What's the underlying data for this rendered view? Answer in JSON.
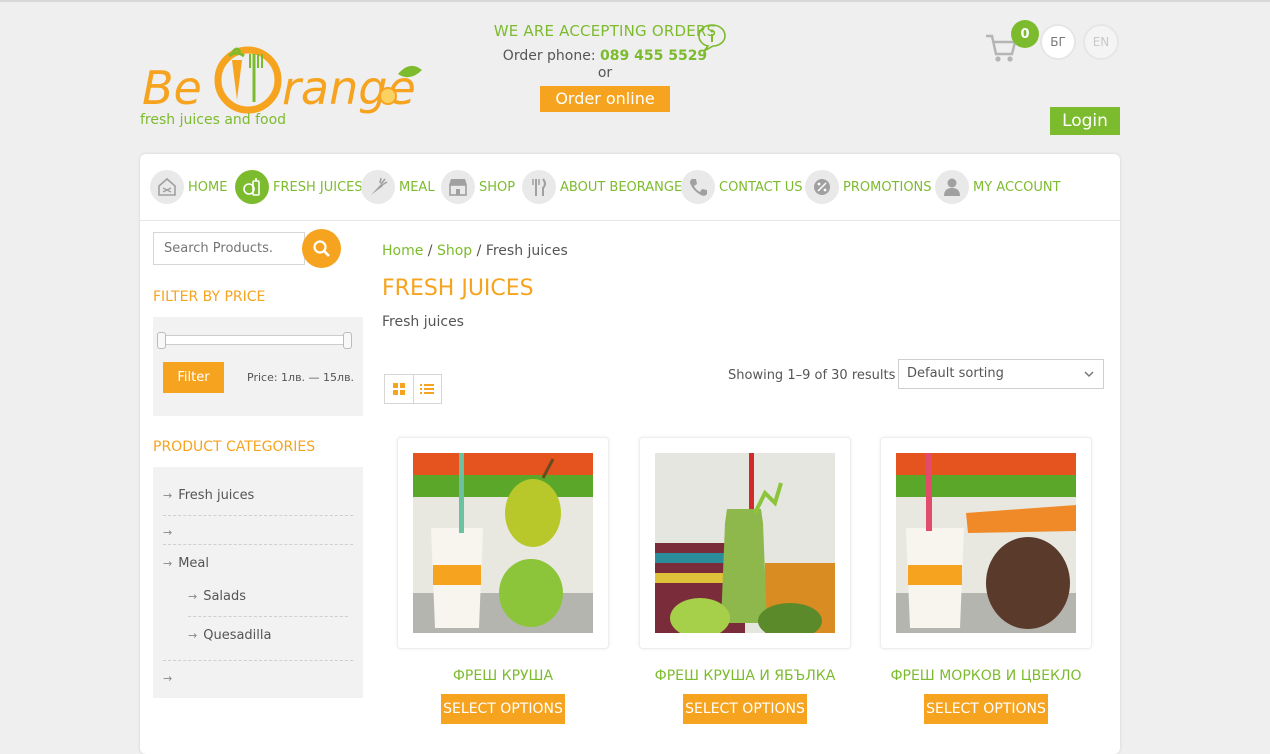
{
  "brand": {
    "logo_text": "BeOrange",
    "tagline": "fresh juices and food"
  },
  "header": {
    "accepting": "WE ARE ACCEPTING ORDERS",
    "order_phone_label": "Order phone:",
    "order_phone": "089 455 5529",
    "or": "or",
    "order_online": "Order online",
    "cart_count": "0",
    "lang_bg": "БГ",
    "lang_en": "EN",
    "login": "Login"
  },
  "nav": [
    {
      "label": "HOME",
      "icon": "home-icon"
    },
    {
      "label": "FRESH JUICES",
      "icon": "juice-icon"
    },
    {
      "label": "MEAL",
      "icon": "carrot-icon"
    },
    {
      "label": "SHOP",
      "icon": "shop-icon"
    },
    {
      "label": "ABOUT BEORANGE",
      "icon": "cutlery-icon"
    },
    {
      "label": "CONTACT US",
      "icon": "phone-icon"
    },
    {
      "label": "PROMOTIONS",
      "icon": "percent-icon"
    },
    {
      "label": "MY ACCOUNT",
      "icon": "user-icon"
    }
  ],
  "sidebar": {
    "search_placeholder": "Search Products.",
    "filter_title": "FILTER BY PRICE",
    "filter_button": "Filter",
    "price_label": "Price: 1лв. — 15лв.",
    "price_range": {
      "min": 1,
      "max": 15,
      "selected_min": 1,
      "selected_max": 15
    },
    "categories_title": "PRODUCT CATEGORIES",
    "categories": [
      {
        "label": "Fresh juices",
        "level": 0
      },
      {
        "label": "",
        "level": 0
      },
      {
        "label": "Meal",
        "level": 0
      },
      {
        "label": "Salads",
        "level": 1
      },
      {
        "label": "Quesadilla",
        "level": 1
      },
      {
        "label": "",
        "level": 0
      }
    ]
  },
  "main": {
    "breadcrumb": {
      "home": "Home",
      "sep1": " / ",
      "shop": "Shop",
      "sep2": " / ",
      "current": "Fresh juices"
    },
    "title": "FRESH JUICES",
    "subtitle": "Fresh juices",
    "results": "Showing 1–9 of 30 results",
    "sorting": "Default sorting",
    "products": [
      {
        "name": "ФРЕШ КРУША",
        "button": "SELECT OPTIONS"
      },
      {
        "name": "ФРЕШ КРУША И ЯБЪЛКА",
        "button": "SELECT OPTIONS"
      },
      {
        "name": "ФРЕШ МОРКОВ И ЦВЕКЛО",
        "button": "SELECT OPTIONS"
      }
    ]
  },
  "colors": {
    "accent_orange": "#f6a31f",
    "accent_green": "#7dbb2e",
    "background": "#efefef"
  }
}
